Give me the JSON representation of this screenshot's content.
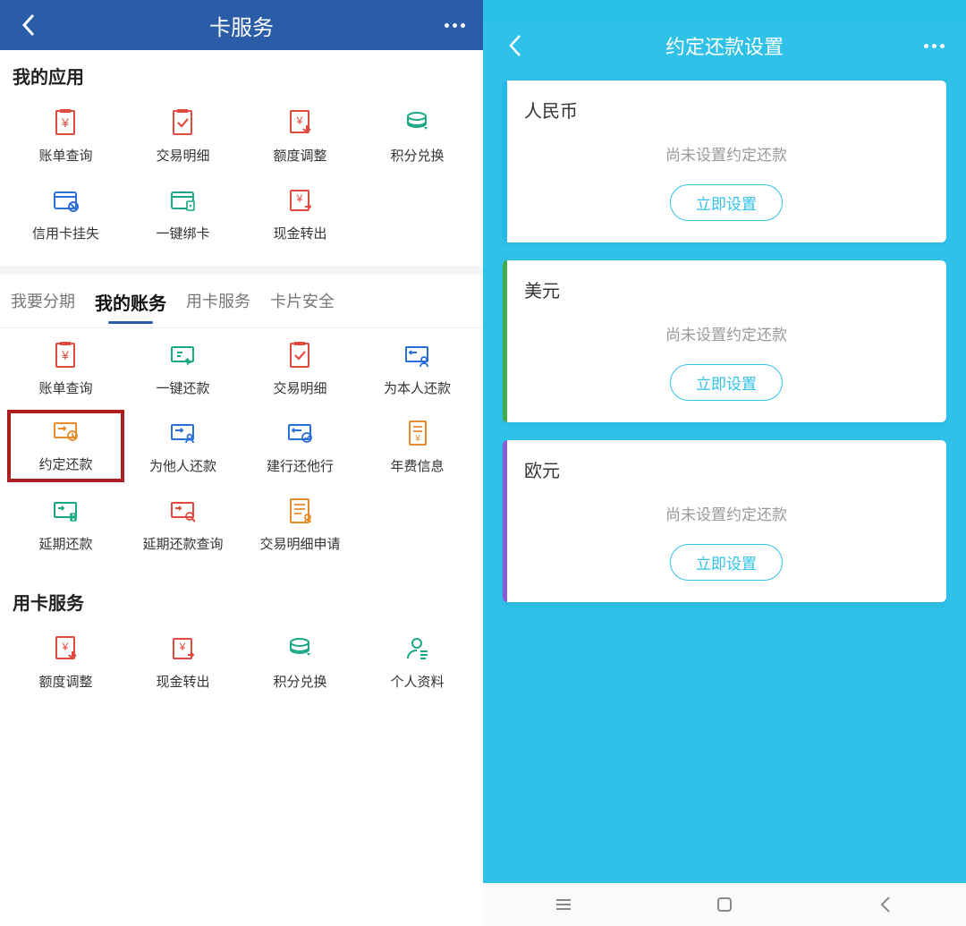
{
  "left": {
    "header": {
      "title": "卡服务"
    },
    "section1_title": "我的应用",
    "apps": [
      {
        "label": "账单查询",
        "icon": "bill",
        "color": "#e14a3f"
      },
      {
        "label": "交易明细",
        "icon": "check-doc",
        "color": "#e14a3f"
      },
      {
        "label": "额度调整",
        "icon": "limit",
        "color": "#e14a3f"
      },
      {
        "label": "积分兑换",
        "icon": "coins",
        "color": "#1aa884"
      },
      {
        "label": "信用卡挂失",
        "icon": "card-lost",
        "color": "#2a6fd6"
      },
      {
        "label": "一键绑卡",
        "icon": "card-bind",
        "color": "#1aa884"
      },
      {
        "label": "现金转出",
        "icon": "cash-out",
        "color": "#e14a3f"
      }
    ],
    "tabs": [
      {
        "label": "我要分期"
      },
      {
        "label": "我的账务",
        "active": true
      },
      {
        "label": "用卡服务"
      },
      {
        "label": "卡片安全"
      }
    ],
    "accounts_grid": [
      {
        "label": "账单查询",
        "icon": "bill",
        "color": "#e14a3f"
      },
      {
        "label": "一键还款",
        "icon": "repay-click",
        "color": "#1aa884"
      },
      {
        "label": "交易明细",
        "icon": "check-doc",
        "color": "#e14a3f"
      },
      {
        "label": "为本人还款",
        "icon": "repay-self",
        "color": "#2a6fd6"
      },
      {
        "label": "约定还款",
        "icon": "repay-sched",
        "color": "#e98a2a",
        "highlight": true
      },
      {
        "label": "为他人还款",
        "icon": "repay-other",
        "color": "#2a6fd6"
      },
      {
        "label": "建行还他行",
        "icon": "repay-bank",
        "color": "#2a6fd6"
      },
      {
        "label": "年费信息",
        "icon": "fee",
        "color": "#e98a2a"
      },
      {
        "label": "延期还款",
        "icon": "defer",
        "color": "#1aa884"
      },
      {
        "label": "延期还款查询",
        "icon": "defer-q",
        "color": "#e14a3f"
      },
      {
        "label": "交易明细申请",
        "icon": "detail-apply",
        "color": "#e98a2a"
      }
    ],
    "section3_title": "用卡服务",
    "services_grid": [
      {
        "label": "额度调整",
        "icon": "limit",
        "color": "#e14a3f"
      },
      {
        "label": "现金转出",
        "icon": "cash-out",
        "color": "#e14a3f"
      },
      {
        "label": "积分兑换",
        "icon": "coins",
        "color": "#1aa884"
      },
      {
        "label": "个人资料",
        "icon": "profile",
        "color": "#1aa884"
      }
    ]
  },
  "right": {
    "header": {
      "title": "约定还款设置"
    },
    "cards": [
      {
        "currency": "人民币",
        "msg": "尚未设置约定还款",
        "btn": "立即设置",
        "accent": "blue"
      },
      {
        "currency": "美元",
        "msg": "尚未设置约定还款",
        "btn": "立即设置",
        "accent": "green"
      },
      {
        "currency": "欧元",
        "msg": "尚未设置约定还款",
        "btn": "立即设置",
        "accent": "purple"
      }
    ]
  }
}
